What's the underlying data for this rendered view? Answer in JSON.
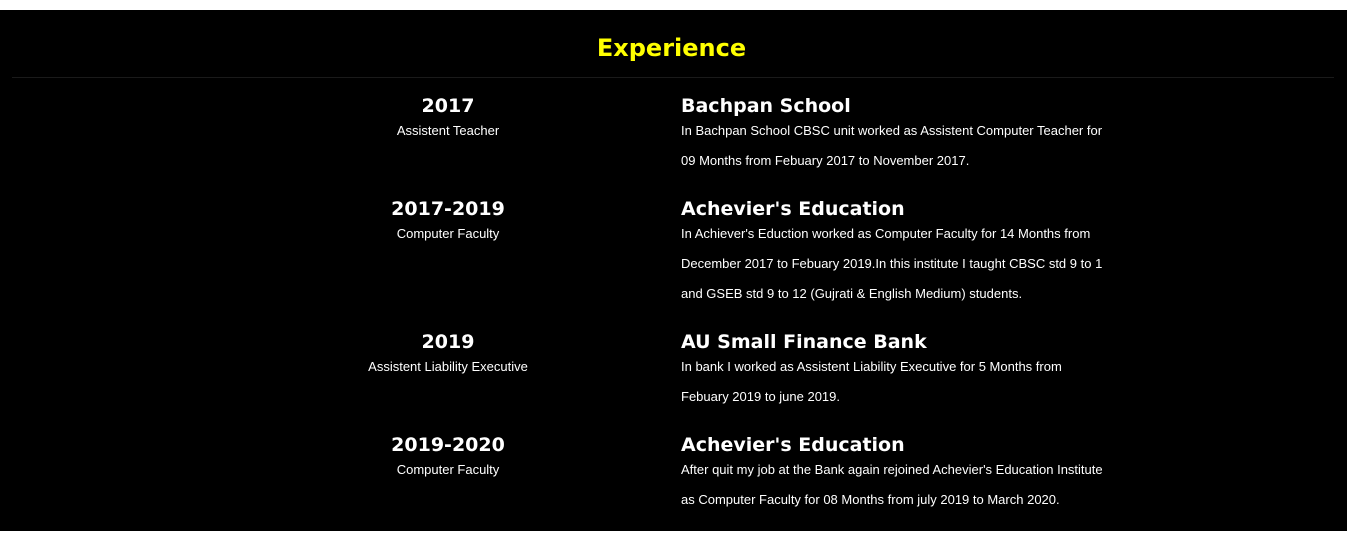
{
  "section": {
    "title": "Experience"
  },
  "colors": {
    "background": "#000000",
    "title": "#ffff00",
    "text": "#ffffff"
  },
  "experience": [
    {
      "year": "2017",
      "role": "Assistent Teacher",
      "organization": "Bachpan School",
      "description": "In Bachpan School CBSC unit worked as Assistent Computer Teacher for 09 Months from Febuary 2017 to November 2017."
    },
    {
      "year": "2017-2019",
      "role": "Computer Faculty",
      "organization": "Achevier's Education",
      "description": "In Achiever's Eduction worked as Computer Faculty for 14 Months from December 2017 to Febuary 2019.In this institute I taught CBSC std 9 to 1 and GSEB std 9 to 12 (Gujrati & English Medium) students."
    },
    {
      "year": "2019",
      "role": "Assistent Liability Executive",
      "organization": "AU Small Finance Bank",
      "description": "In bank I worked as Assistent Liability Executive for 5 Months from Febuary 2019 to june 2019."
    },
    {
      "year": "2019-2020",
      "role": "Computer Faculty",
      "organization": "Achevier's Education",
      "description": "After quit my job at the Bank again rejoined Achevier's Education Institute as Computer Faculty for 08 Months from july 2019 to March 2020."
    }
  ]
}
